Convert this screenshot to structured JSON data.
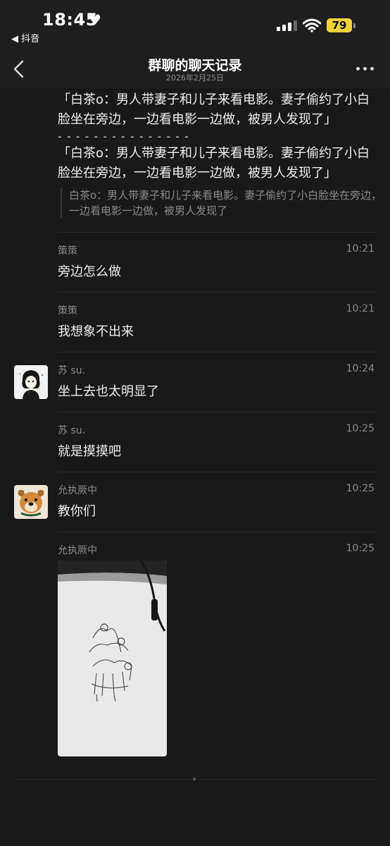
{
  "status": {
    "time": "18:45",
    "back_app": "◀ 抖音",
    "battery": "79",
    "icons": [
      "heart-icon",
      "signal-icon",
      "wifi-icon",
      "battery-icon"
    ]
  },
  "nav": {
    "title": "群聊的聊天记录",
    "subtitle": "2026年2月25日"
  },
  "quote": {
    "line1": "「白茶o：男人带妻子和儿子来看电影。妻子偷约了小白脸坐在旁边，一边看电影一边做，被男人发现了」",
    "separator": "- - - - - - - - - - - - - - -",
    "line2": "「白茶o：男人带妻子和儿子来看电影。妻子偷约了小白脸坐在旁边，一边看电影一边做，被男人发现了」",
    "reference": "白茶o：男人带妻子和儿子来看电影。妻子偷约了小白脸坐在旁边，一边看电影一边做，被男人发现了"
  },
  "messages": [
    {
      "sender": "策策",
      "time": "10:21",
      "text": "旁边怎么做",
      "avatar": ""
    },
    {
      "sender": "策策",
      "time": "10:21",
      "text": "我想象不出来",
      "avatar": ""
    },
    {
      "sender": "苏 su.",
      "time": "10:24",
      "text": "坐上去也太明显了",
      "avatar": "girl-sketch-avatar"
    },
    {
      "sender": "苏 su.",
      "time": "10:25",
      "text": "就是摸摸吧",
      "avatar": ""
    },
    {
      "sender": "允执厥中",
      "time": "10:25",
      "text": "教你们",
      "avatar": "dog-avatar"
    },
    {
      "sender": "允执厥中",
      "time": "10:25",
      "text": "",
      "avatar": "",
      "image": "photo-of-sketch-with-earphone-cable"
    }
  ]
}
